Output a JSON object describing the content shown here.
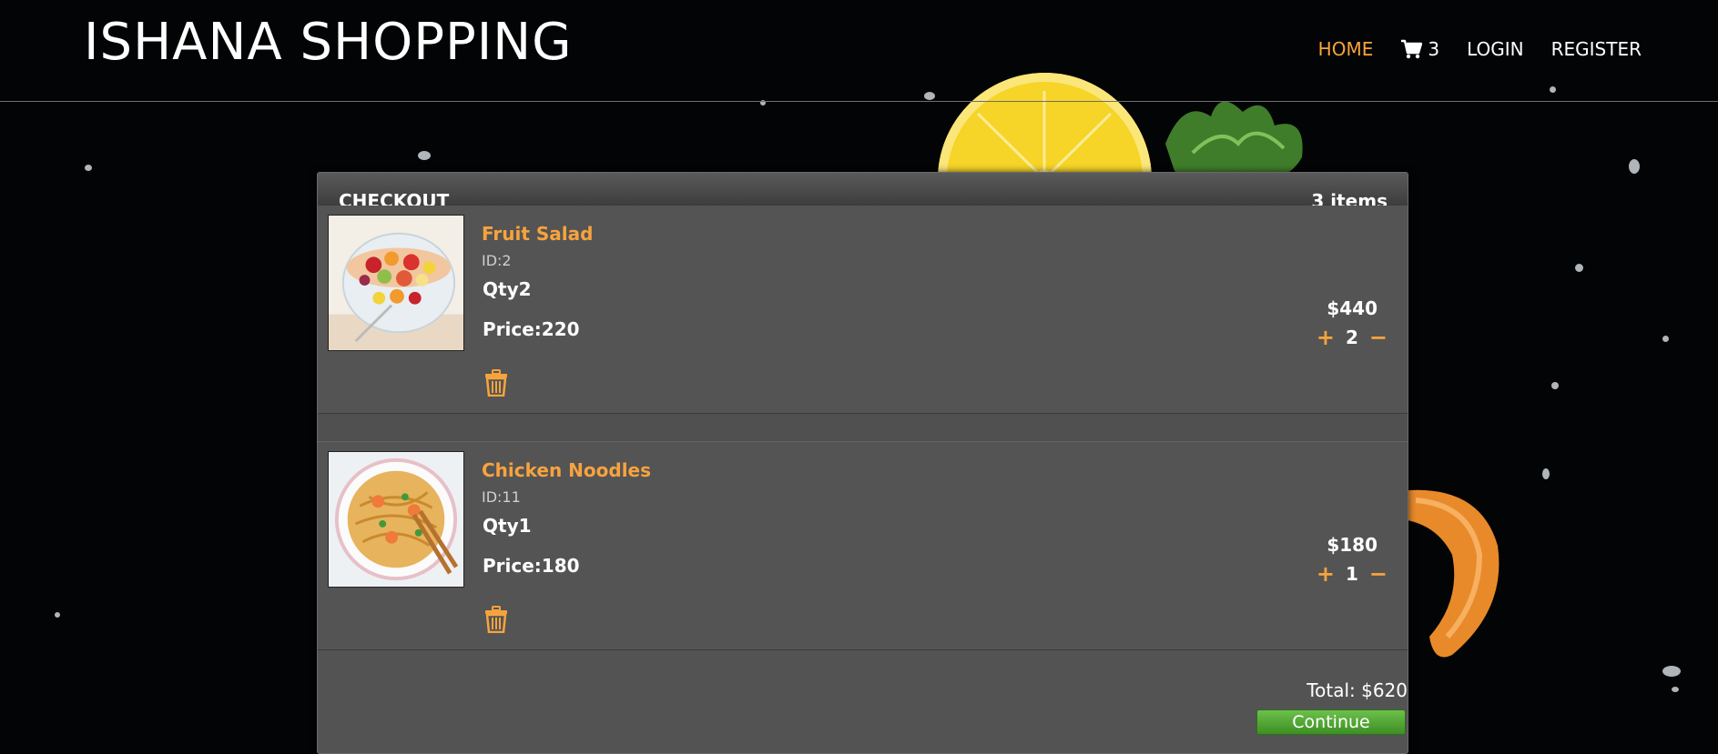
{
  "header": {
    "brand": "ISHANA SHOPPING",
    "nav": {
      "home": "HOME",
      "cart_count": "3",
      "login": "LOGIN",
      "register": "REGISTER"
    },
    "accent_color": "#f7a33d"
  },
  "checkout": {
    "title": "CHECKOUT",
    "item_count": "3 items",
    "items": [
      {
        "name": "Fruit Salad",
        "id": "ID:2",
        "qty": "Qty2",
        "price": "Price:220",
        "total": "$440",
        "qty_value": "2",
        "plus": "+",
        "minus": "−",
        "image": "fruit-salad-image",
        "delete_icon": "trash-icon"
      },
      {
        "name": "Chicken Noodles",
        "id": "ID:11",
        "qty": "Qty1",
        "price": "Price:180",
        "total": "$180",
        "qty_value": "1",
        "plus": "+",
        "minus": "−",
        "image": "chicken-noodles-image",
        "delete_icon": "trash-icon"
      }
    ],
    "total": "Total: $620",
    "continue_label": "Continue",
    "continue_color": "#4ea52f"
  }
}
